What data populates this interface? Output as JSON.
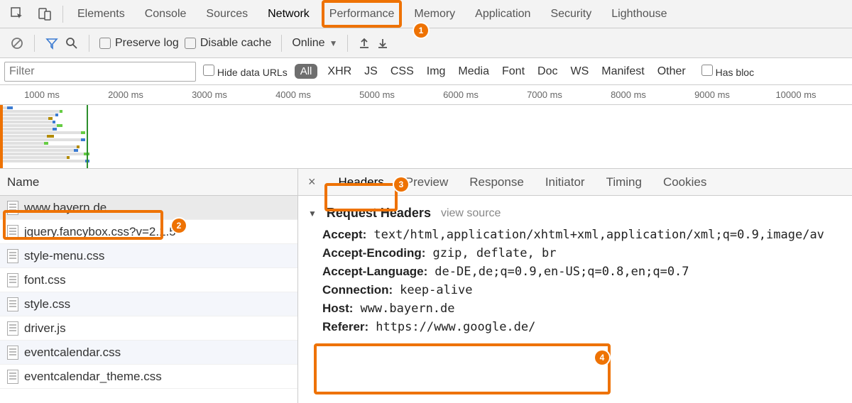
{
  "tabs": {
    "items": [
      "Elements",
      "Console",
      "Sources",
      "Network",
      "Performance",
      "Memory",
      "Application",
      "Security",
      "Lighthouse"
    ],
    "active": "Network"
  },
  "toolbar": {
    "preserve_log": "Preserve log",
    "disable_cache": "Disable cache",
    "online": "Online"
  },
  "filter": {
    "placeholder": "Filter",
    "hide_data_urls": "Hide data URLs",
    "all_pill": "All",
    "types": [
      "XHR",
      "JS",
      "CSS",
      "Img",
      "Media",
      "Font",
      "Doc",
      "WS",
      "Manifest",
      "Other"
    ],
    "has_blocked": "Has bloc"
  },
  "ruler": [
    "1000 ms",
    "2000 ms",
    "3000 ms",
    "4000 ms",
    "5000 ms",
    "6000 ms",
    "7000 ms",
    "8000 ms",
    "9000 ms",
    "10000 ms"
  ],
  "name_header": "Name",
  "requests": [
    "www.bayern.de",
    "jquery.fancybox.css?v=2.1.5",
    "style-menu.css",
    "font.css",
    "style.css",
    "driver.js",
    "eventcalendar.css",
    "eventcalendar_theme.css"
  ],
  "selected_request_index": 0,
  "detail_tabs": {
    "items": [
      "Headers",
      "Preview",
      "Response",
      "Initiator",
      "Timing",
      "Cookies"
    ],
    "active": "Headers"
  },
  "headers_section": {
    "title": "Request Headers",
    "view_source": "view source",
    "rows": [
      {
        "k": "Accept:",
        "v": "text/html,application/xhtml+xml,application/xml;q=0.9,image/av"
      },
      {
        "k": "Accept-Encoding:",
        "v": "gzip, deflate, br"
      },
      {
        "k": "Accept-Language:",
        "v": "de-DE,de;q=0.9,en-US;q=0.8,en;q=0.7"
      },
      {
        "k": "Connection:",
        "v": "keep-alive"
      },
      {
        "k": "Host:",
        "v": "www.bayern.de"
      },
      {
        "k": "Referer:",
        "v": "https://www.google.de/"
      }
    ]
  },
  "callouts": {
    "c1": "1",
    "c2": "2",
    "c3": "3",
    "c4": "4"
  }
}
